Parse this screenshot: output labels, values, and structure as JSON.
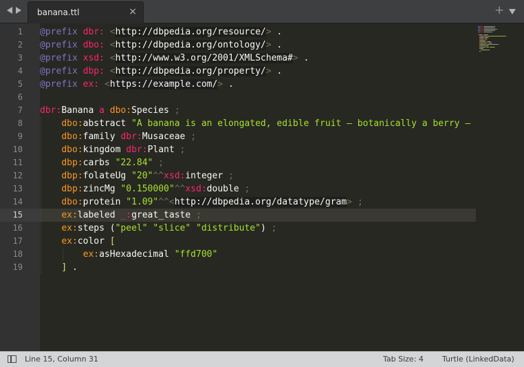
{
  "tab": {
    "title": "banana.ttl",
    "close": "×",
    "add": "+"
  },
  "editor": {
    "active_line": 15,
    "line_numbers": [
      "1",
      "2",
      "3",
      "4",
      "5",
      "6",
      "7",
      "8",
      "9",
      "10",
      "11",
      "12",
      "13",
      "14",
      "15",
      "16",
      "17",
      "18",
      "19"
    ],
    "lines": [
      [
        [
          "kw",
          "@prefix"
        ],
        [
          "pl",
          " "
        ],
        [
          "pfx",
          "dbr:"
        ],
        [
          "pl",
          " "
        ],
        [
          "lt",
          "<"
        ],
        [
          "iri",
          "http://dbpedia.org/resource/"
        ],
        [
          "lt",
          ">"
        ],
        [
          "pl",
          " ."
        ]
      ],
      [
        [
          "kw",
          "@prefix"
        ],
        [
          "pl",
          " "
        ],
        [
          "pfx",
          "dbo:"
        ],
        [
          "pl",
          " "
        ],
        [
          "lt",
          "<"
        ],
        [
          "iri",
          "http://dbpedia.org/ontology/"
        ],
        [
          "lt",
          ">"
        ],
        [
          "pl",
          " ."
        ]
      ],
      [
        [
          "kw",
          "@prefix"
        ],
        [
          "pl",
          " "
        ],
        [
          "pfx",
          "xsd:"
        ],
        [
          "pl",
          " "
        ],
        [
          "lt",
          "<"
        ],
        [
          "iri",
          "http://www.w3.org/2001/XMLSchema#"
        ],
        [
          "lt",
          ">"
        ],
        [
          "pl",
          " ."
        ]
      ],
      [
        [
          "kw",
          "@prefix"
        ],
        [
          "pl",
          " "
        ],
        [
          "pfx",
          "dbp:"
        ],
        [
          "pl",
          " "
        ],
        [
          "lt",
          "<"
        ],
        [
          "iri",
          "http://dbpedia.org/property/"
        ],
        [
          "lt",
          ">"
        ],
        [
          "pl",
          " ."
        ]
      ],
      [
        [
          "kw",
          "@prefix"
        ],
        [
          "pl",
          " "
        ],
        [
          "pfx",
          "ex:"
        ],
        [
          "pl",
          " "
        ],
        [
          "lt",
          "<"
        ],
        [
          "iri",
          "https://example.com/"
        ],
        [
          "lt",
          ">"
        ],
        [
          "pl",
          " ."
        ]
      ],
      [],
      [
        [
          "pfx",
          "dbr:"
        ],
        [
          "pl",
          "Banana "
        ],
        [
          "a",
          "a"
        ],
        [
          "pl",
          " "
        ],
        [
          "dbo",
          "dbo:"
        ],
        [
          "pl",
          "Species "
        ],
        [
          "pun",
          ";"
        ]
      ],
      [
        [
          "pl",
          "    "
        ],
        [
          "dbo",
          "dbo:"
        ],
        [
          "pl",
          "abstract "
        ],
        [
          "str",
          "\"A banana is an elongated, edible fruit – botanically a berry –"
        ]
      ],
      [
        [
          "pl",
          "    "
        ],
        [
          "dbo",
          "dbo:"
        ],
        [
          "pl",
          "family "
        ],
        [
          "pfx",
          "dbr:"
        ],
        [
          "pl",
          "Musaceae "
        ],
        [
          "pun",
          ";"
        ]
      ],
      [
        [
          "pl",
          "    "
        ],
        [
          "dbo",
          "dbo:"
        ],
        [
          "pl",
          "kingdom "
        ],
        [
          "pfx",
          "dbr:"
        ],
        [
          "pl",
          "Plant "
        ],
        [
          "pun",
          ";"
        ]
      ],
      [
        [
          "pl",
          "    "
        ],
        [
          "dbp",
          "dbp:"
        ],
        [
          "pl",
          "carbs "
        ],
        [
          "str",
          "\"22.84\""
        ],
        [
          "pl",
          " "
        ],
        [
          "pun",
          ";"
        ]
      ],
      [
        [
          "pl",
          "    "
        ],
        [
          "dbp",
          "dbp:"
        ],
        [
          "pl",
          "folateUg "
        ],
        [
          "str",
          "\"20\""
        ],
        [
          "hat",
          "^^"
        ],
        [
          "pfx",
          "xsd:"
        ],
        [
          "pl",
          "integer "
        ],
        [
          "pun",
          ";"
        ]
      ],
      [
        [
          "pl",
          "    "
        ],
        [
          "dbp",
          "dbp:"
        ],
        [
          "pl",
          "zincMg "
        ],
        [
          "str",
          "\"0.150000\""
        ],
        [
          "hat",
          "^^"
        ],
        [
          "pfx",
          "xsd:"
        ],
        [
          "pl",
          "double "
        ],
        [
          "pun",
          ";"
        ]
      ],
      [
        [
          "pl",
          "    "
        ],
        [
          "dbo",
          "dbo:"
        ],
        [
          "pl",
          "protein "
        ],
        [
          "str",
          "\"1.09\""
        ],
        [
          "hat",
          "^^"
        ],
        [
          "lt",
          "<"
        ],
        [
          "iri",
          "http://dbpedia.org/datatype/gram"
        ],
        [
          "lt",
          ">"
        ],
        [
          "pl",
          " "
        ],
        [
          "pun",
          ";"
        ]
      ],
      [
        [
          "pl",
          "    "
        ],
        [
          "ex",
          "ex:"
        ],
        [
          "pl",
          "labeled "
        ],
        [
          "pfx",
          "_:"
        ],
        [
          "pl",
          "great_taste "
        ],
        [
          "pun",
          ";"
        ]
      ],
      [
        [
          "pl",
          "    "
        ],
        [
          "ex",
          "ex:"
        ],
        [
          "pl",
          "steps ("
        ],
        [
          "str",
          "\"peel\""
        ],
        [
          "pl",
          " "
        ],
        [
          "str",
          "\"slice\""
        ],
        [
          "pl",
          " "
        ],
        [
          "str",
          "\"distribute\""
        ],
        [
          "pl",
          ") "
        ],
        [
          "pun",
          ";"
        ]
      ],
      [
        [
          "pl",
          "    "
        ],
        [
          "ex",
          "ex:"
        ],
        [
          "pl",
          "color "
        ],
        [
          "bracket",
          "["
        ]
      ],
      [
        [
          "pl",
          "        "
        ],
        [
          "ex",
          "ex:"
        ],
        [
          "pl",
          "asHexadecimal "
        ],
        [
          "str",
          "\"ffd700\""
        ]
      ],
      [
        [
          "pl",
          "    "
        ],
        [
          "bracket",
          "]"
        ],
        [
          "pl",
          " ."
        ]
      ]
    ]
  },
  "status": {
    "position": "Line 15, Column 31",
    "tab_size": "Tab Size: 4",
    "syntax": "Turtle (LinkedData)"
  },
  "colors": {
    "keyword": "#7f74c8",
    "prefix": "#f92672",
    "string": "#a6e22e",
    "background": "#272822"
  }
}
